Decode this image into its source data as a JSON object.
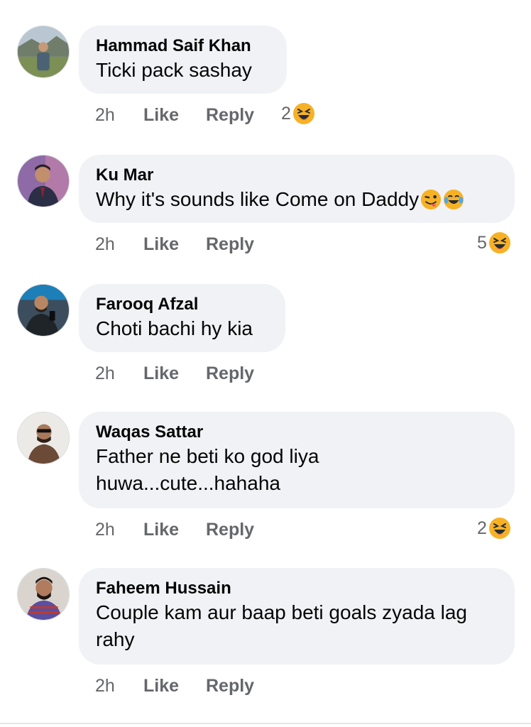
{
  "comments": [
    {
      "author": "Hammad Saif Khan",
      "text": "Ticki pack sashay",
      "time": "2h",
      "like": "Like",
      "reply": "Reply",
      "reaction_count": "2",
      "reaction_icon": "laughing-squint-emoji"
    },
    {
      "author": "Ku Mar",
      "text": "Why it's sounds like Come on Daddy",
      "time": "2h",
      "like": "Like",
      "reply": "Reply",
      "reaction_count": "5",
      "reaction_icon": "laughing-squint-emoji",
      "inline_emoji": [
        "winking-tongue-emoji",
        "tears-of-joy-emoji"
      ]
    },
    {
      "author": "Farooq Afzal",
      "text": "Choti bachi hy kia",
      "time": "2h",
      "like": "Like",
      "reply": "Reply"
    },
    {
      "author": "Waqas Sattar",
      "text_line1": "Father ne beti ko god liya",
      "text_line2": "huwa...cute...hahaha",
      "time": "2h",
      "like": "Like",
      "reply": "Reply",
      "reaction_count": "2",
      "reaction_icon": "laughing-squint-emoji"
    },
    {
      "author": "Faheem Hussain",
      "text_line1": "Couple kam aur baap beti goals zyada lag",
      "text_line2": "rahy",
      "time": "2h",
      "like": "Like",
      "reply": "Reply"
    }
  ],
  "colors": {
    "bubble": "#f0f2f5",
    "meta": "#65676b",
    "text": "#050505",
    "emoji": "#f7b125"
  }
}
